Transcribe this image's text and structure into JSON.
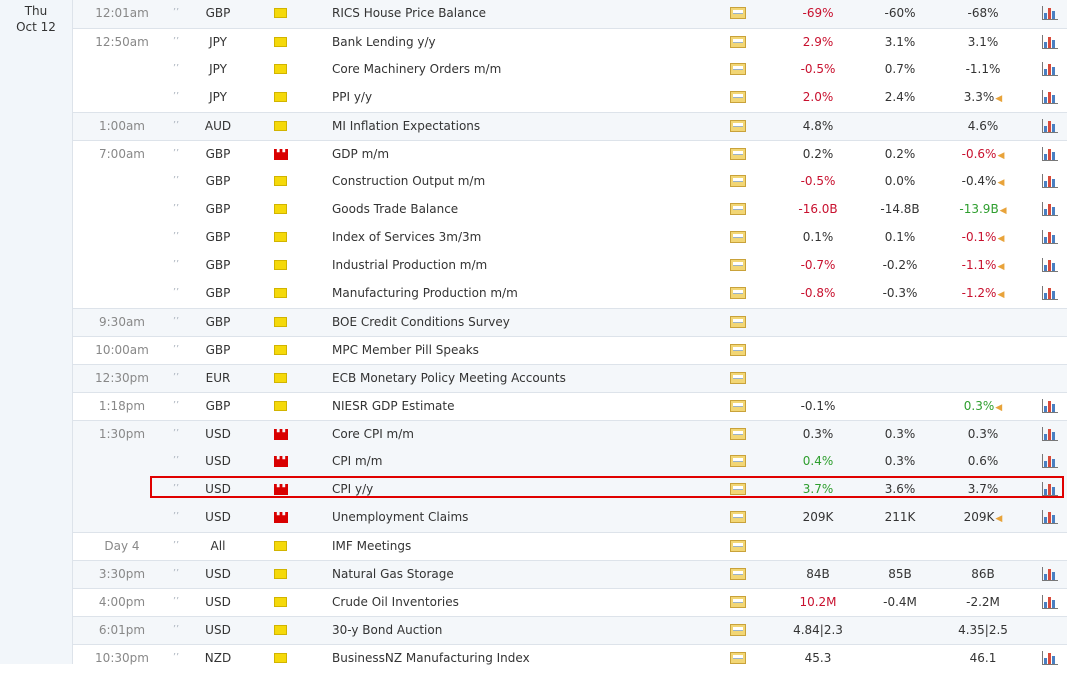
{
  "date": {
    "weekday": "Thu",
    "monthday": "Oct 12"
  },
  "icons": {
    "speaker": "speaker-icon",
    "importance_low": "importance-low-icon",
    "importance_high": "importance-high-icon",
    "details": "folder-details-icon",
    "chart": "bar-chart-icon"
  },
  "colors": {
    "negative": "#c8102e",
    "positive": "#2e9e2e",
    "neutral": "#333333",
    "highlight": "#e00000"
  },
  "rows": [
    {
      "time": "12:01am",
      "currency": "GBP",
      "importance": "low",
      "event": "RICS House Price Balance",
      "actual": "-69%",
      "actual_tone": "neg",
      "forecast": "-60%",
      "previous": "-68%",
      "previous_tone": "neu",
      "revised": false,
      "chart": true
    },
    {
      "time": "12:50am",
      "currency": "JPY",
      "importance": "low",
      "event": "Bank Lending y/y",
      "actual": "2.9%",
      "actual_tone": "neg",
      "forecast": "3.1%",
      "previous": "3.1%",
      "previous_tone": "neu",
      "revised": false,
      "chart": true
    },
    {
      "time": "",
      "currency": "JPY",
      "importance": "low",
      "event": "Core Machinery Orders m/m",
      "actual": "-0.5%",
      "actual_tone": "neg",
      "forecast": "0.7%",
      "previous": "-1.1%",
      "previous_tone": "neu",
      "revised": false,
      "chart": true
    },
    {
      "time": "",
      "currency": "JPY",
      "importance": "low",
      "event": "PPI y/y",
      "actual": "2.0%",
      "actual_tone": "neg",
      "forecast": "2.4%",
      "previous": "3.3%",
      "previous_tone": "neu",
      "revised": true,
      "chart": true
    },
    {
      "time": "1:00am",
      "currency": "AUD",
      "importance": "low",
      "event": "MI Inflation Expectations",
      "actual": "4.8%",
      "actual_tone": "neu",
      "forecast": "",
      "previous": "4.6%",
      "previous_tone": "neu",
      "revised": false,
      "chart": true
    },
    {
      "time": "7:00am",
      "currency": "GBP",
      "importance": "high",
      "event": "GDP m/m",
      "actual": "0.2%",
      "actual_tone": "neu",
      "forecast": "0.2%",
      "previous": "-0.6%",
      "previous_tone": "neg",
      "revised": true,
      "chart": true
    },
    {
      "time": "",
      "currency": "GBP",
      "importance": "low",
      "event": "Construction Output m/m",
      "actual": "-0.5%",
      "actual_tone": "neg",
      "forecast": "0.0%",
      "previous": "-0.4%",
      "previous_tone": "neu",
      "revised": true,
      "chart": true
    },
    {
      "time": "",
      "currency": "GBP",
      "importance": "low",
      "event": "Goods Trade Balance",
      "actual": "-16.0B",
      "actual_tone": "neg",
      "forecast": "-14.8B",
      "previous": "-13.9B",
      "previous_tone": "pos",
      "revised": true,
      "chart": true
    },
    {
      "time": "",
      "currency": "GBP",
      "importance": "low",
      "event": "Index of Services 3m/3m",
      "actual": "0.1%",
      "actual_tone": "neu",
      "forecast": "0.1%",
      "previous": "-0.1%",
      "previous_tone": "neg",
      "revised": true,
      "chart": true
    },
    {
      "time": "",
      "currency": "GBP",
      "importance": "low",
      "event": "Industrial Production m/m",
      "actual": "-0.7%",
      "actual_tone": "neg",
      "forecast": "-0.2%",
      "previous": "-1.1%",
      "previous_tone": "neg",
      "revised": true,
      "chart": true
    },
    {
      "time": "",
      "currency": "GBP",
      "importance": "low",
      "event": "Manufacturing Production m/m",
      "actual": "-0.8%",
      "actual_tone": "neg",
      "forecast": "-0.3%",
      "previous": "-1.2%",
      "previous_tone": "neg",
      "revised": true,
      "chart": true
    },
    {
      "time": "9:30am",
      "currency": "GBP",
      "importance": "low",
      "event": "BOE Credit Conditions Survey",
      "actual": "",
      "actual_tone": "neu",
      "forecast": "",
      "previous": "",
      "previous_tone": "neu",
      "revised": false,
      "chart": false
    },
    {
      "time": "10:00am",
      "currency": "GBP",
      "importance": "low",
      "event": "MPC Member Pill Speaks",
      "actual": "",
      "actual_tone": "neu",
      "forecast": "",
      "previous": "",
      "previous_tone": "neu",
      "revised": false,
      "chart": false
    },
    {
      "time": "12:30pm",
      "currency": "EUR",
      "importance": "low",
      "event": "ECB Monetary Policy Meeting Accounts",
      "actual": "",
      "actual_tone": "neu",
      "forecast": "",
      "previous": "",
      "previous_tone": "neu",
      "revised": false,
      "chart": false
    },
    {
      "time": "1:18pm",
      "currency": "GBP",
      "importance": "low",
      "event": "NIESR GDP Estimate",
      "actual": "-0.1%",
      "actual_tone": "neu",
      "forecast": "",
      "previous": "0.3%",
      "previous_tone": "pos",
      "revised": true,
      "chart": true
    },
    {
      "time": "1:30pm",
      "currency": "USD",
      "importance": "high",
      "event": "Core CPI m/m",
      "actual": "0.3%",
      "actual_tone": "neu",
      "forecast": "0.3%",
      "previous": "0.3%",
      "previous_tone": "neu",
      "revised": false,
      "chart": true
    },
    {
      "time": "",
      "currency": "USD",
      "importance": "high",
      "event": "CPI m/m",
      "actual": "0.4%",
      "actual_tone": "pos",
      "forecast": "0.3%",
      "previous": "0.6%",
      "previous_tone": "neu",
      "revised": false,
      "chart": true
    },
    {
      "time": "",
      "currency": "USD",
      "importance": "high",
      "event": "CPI y/y",
      "actual": "3.7%",
      "actual_tone": "pos",
      "forecast": "3.6%",
      "previous": "3.7%",
      "previous_tone": "neu",
      "revised": false,
      "chart": true
    },
    {
      "time": "",
      "currency": "USD",
      "importance": "high",
      "event": "Unemployment Claims",
      "actual": "209K",
      "actual_tone": "neu",
      "forecast": "211K",
      "previous": "209K",
      "previous_tone": "neu",
      "revised": true,
      "chart": true
    },
    {
      "time": "Day 4",
      "currency": "All",
      "importance": "low",
      "event": "IMF Meetings",
      "actual": "",
      "actual_tone": "neu",
      "forecast": "",
      "previous": "",
      "previous_tone": "neu",
      "revised": false,
      "chart": false
    },
    {
      "time": "3:30pm",
      "currency": "USD",
      "importance": "low",
      "event": "Natural Gas Storage",
      "actual": "84B",
      "actual_tone": "neu",
      "forecast": "85B",
      "previous": "86B",
      "previous_tone": "neu",
      "revised": false,
      "chart": true
    },
    {
      "time": "4:00pm",
      "currency": "USD",
      "importance": "low",
      "event": "Crude Oil Inventories",
      "actual": "10.2M",
      "actual_tone": "neg",
      "forecast": "-0.4M",
      "previous": "-2.2M",
      "previous_tone": "neu",
      "revised": false,
      "chart": true
    },
    {
      "time": "6:01pm",
      "currency": "USD",
      "importance": "low",
      "event": "30-y Bond Auction",
      "actual": "4.84|2.3",
      "actual_tone": "neu",
      "forecast": "",
      "previous": "4.35|2.5",
      "previous_tone": "neu",
      "revised": false,
      "chart": false
    },
    {
      "time": "10:30pm",
      "currency": "NZD",
      "importance": "low",
      "event": "BusinessNZ Manufacturing Index",
      "actual": "45.3",
      "actual_tone": "neu",
      "forecast": "",
      "previous": "46.1",
      "previous_tone": "neu",
      "revised": false,
      "chart": true
    }
  ]
}
